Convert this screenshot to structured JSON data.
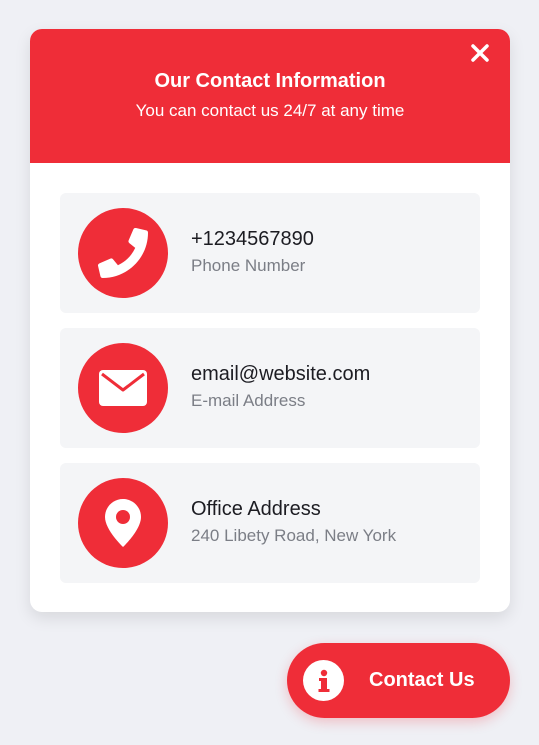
{
  "colors": {
    "accent": "#ef2d38",
    "background": "#eff0f5",
    "card_background": "#f4f5f7",
    "primary_text": "#1c1c22",
    "secondary_text": "#7b7e86"
  },
  "panel": {
    "title": "Our Contact Information",
    "subtitle": "You can contact us 24/7 at any time",
    "close_icon": "close-icon"
  },
  "contacts": [
    {
      "icon": "phone-icon",
      "value": "+1234567890",
      "label": "Phone Number"
    },
    {
      "icon": "envelope-icon",
      "value": "email@website.com",
      "label": "E-mail Address"
    },
    {
      "icon": "map-pin-icon",
      "value": "Office Address",
      "label": "240 Libety Road, New York"
    }
  ],
  "contact_button": {
    "icon": "info-icon",
    "label": "Contact Us"
  }
}
